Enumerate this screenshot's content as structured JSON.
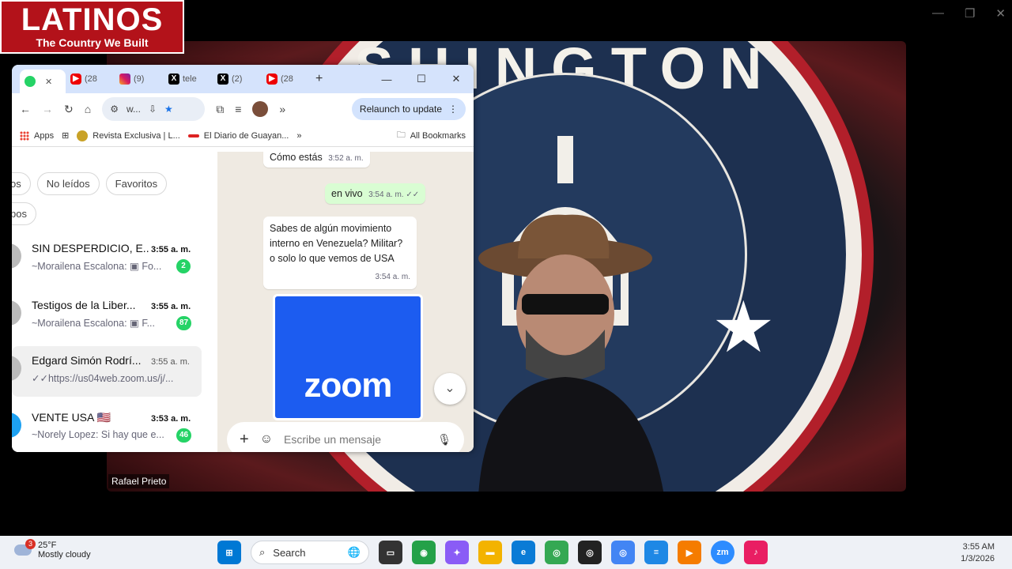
{
  "logo": {
    "brand": "LATINOS",
    "tagline": "The Country We Built"
  },
  "video": {
    "backdrop_text": "SHINGTON",
    "participant_name": "Rafael Prieto"
  },
  "meeting_window_controls": [
    "—",
    "❐",
    "✕"
  ],
  "browser": {
    "tabs": [
      {
        "icon": "whatsapp-icon",
        "label": "",
        "close": "✕"
      },
      {
        "icon": "youtube-icon",
        "label": "(28"
      },
      {
        "icon": "instagram-icon",
        "label": "(9)"
      },
      {
        "icon": "x-icon",
        "label": "tele"
      },
      {
        "icon": "x-icon",
        "label": "(2)"
      },
      {
        "icon": "youtube-icon",
        "label": "(28"
      }
    ],
    "new_tab": "+",
    "window_controls": [
      "—",
      "☐",
      "✕"
    ],
    "omnibox_text": "w...",
    "relaunch_label": "Relaunch to update",
    "bookmarks": {
      "apps": "Apps",
      "item1": "Revista Exclusiva | L...",
      "item2": "El Diario de Guayan...",
      "more": "»",
      "all": "All Bookmarks"
    }
  },
  "whatsapp": {
    "filters": [
      "os",
      "No leídos",
      "Favoritos"
    ],
    "filter_row2": "pos",
    "chats": [
      {
        "title": "SIN DESPERDICIO, E...",
        "time": "3:55 a. m.",
        "preview": "~Morailena Escalona: ▣ Fo...",
        "badge": "2"
      },
      {
        "title": "Testigos de la Liber...",
        "time": "3:55 a. m.",
        "preview": "~Morailena Escalona: ▣ F...",
        "badge": "87"
      },
      {
        "title": "Edgard Simón Rodrí...",
        "time": "3:55 a. m.",
        "preview": "✓✓https://us04web.zoom.us/j/...",
        "badge": ""
      },
      {
        "title": "VENTE USA 🇺🇸",
        "time": "3:53 a. m.",
        "preview": "~Norely Lopez: Si hay que e...",
        "badge": "46"
      }
    ],
    "messages": {
      "m1_text": "Cómo estás",
      "m1_time": "3:52 a. m.",
      "m2_text": "en vivo",
      "m2_time": "3:54 a. m. ✓✓",
      "m3_text": "Sabes de algún movimiento interno en Venezuela? Militar? o solo lo que vemos de USA",
      "m3_time": "3:54 a. m.",
      "image_text": "zoom"
    },
    "composer_placeholder": "Escribe un mensaje"
  },
  "taskbar": {
    "weather_temp": "25°F",
    "weather_desc": "Mostly cloudy",
    "weather_badge": "3",
    "search_label": "Search",
    "time": "3:55 AM",
    "date": "1/3/2026"
  }
}
